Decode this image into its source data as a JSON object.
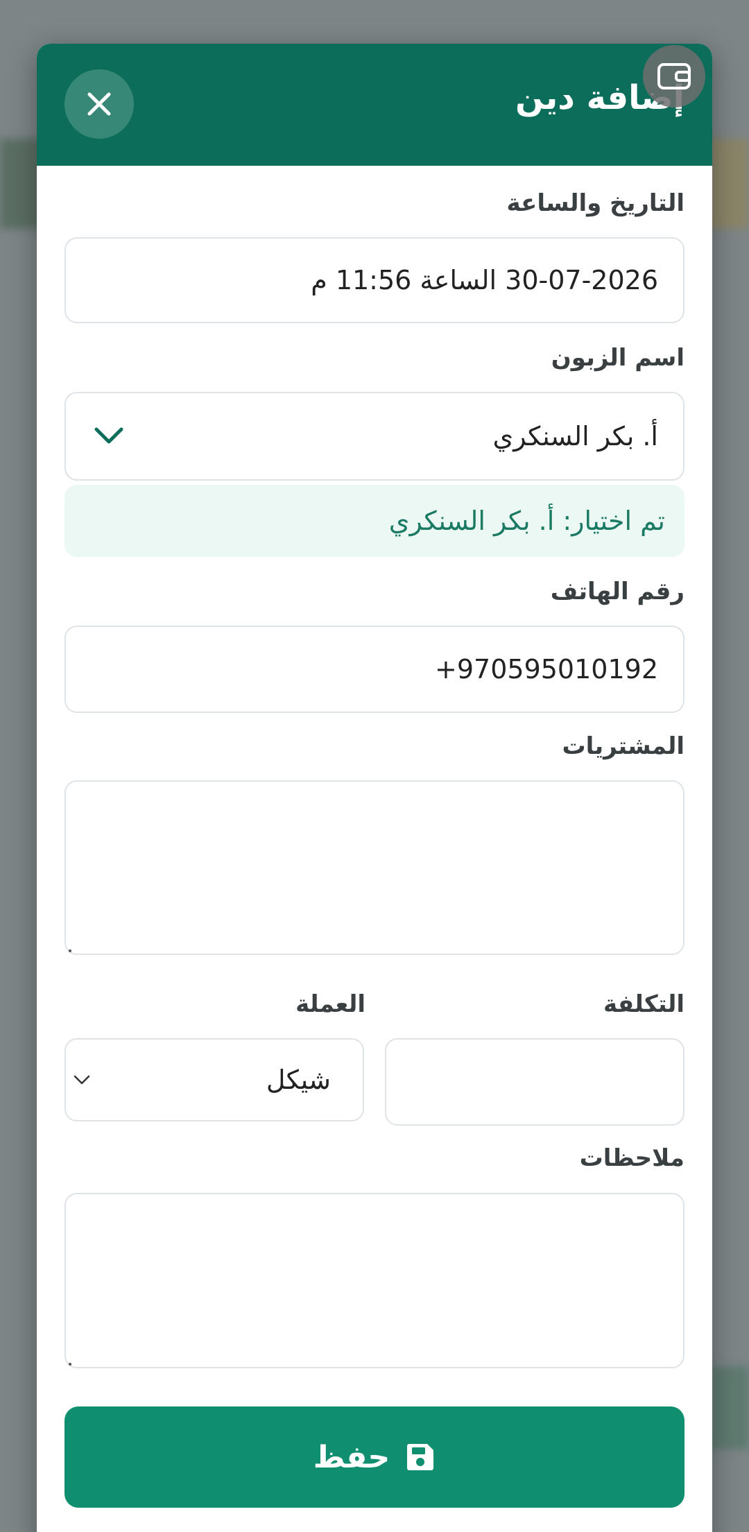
{
  "header": {
    "title": "إضافة دين"
  },
  "form": {
    "datetime": {
      "label": "التاريخ والساعة",
      "value": "30-07-2026 الساعة 11:56 م"
    },
    "customer": {
      "label": "اسم الزبون",
      "value": "أ. بكر السنكري",
      "selected_text": "تم اختيار: أ. بكر السنكري"
    },
    "phone": {
      "label": "رقم الهاتف",
      "value": "+970595010192"
    },
    "purchases": {
      "label": "المشتريات",
      "value": ""
    },
    "cost": {
      "label": "التكلفة",
      "value": ""
    },
    "currency": {
      "label": "العملة",
      "value": "شيكل"
    },
    "notes": {
      "label": "ملاحظات",
      "value": ""
    }
  },
  "actions": {
    "save_label": "حفظ"
  },
  "colors": {
    "primary": "#0c6e5a",
    "button": "#0f8f6f",
    "selected_bg": "#ecf8f3"
  },
  "icons": {
    "close": "close-icon",
    "save": "floppy-disk-icon",
    "corner": "wallet-icon",
    "dropdown": "chevron-down-icon"
  }
}
